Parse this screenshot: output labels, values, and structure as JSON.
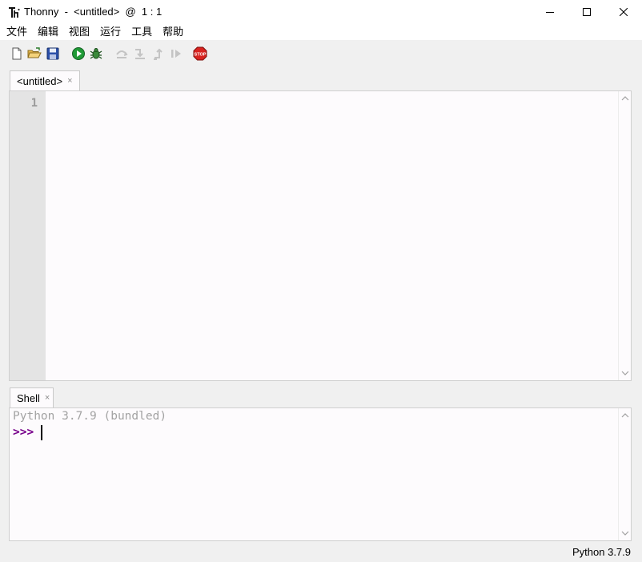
{
  "window": {
    "title": "Thonny  -  <untitled>  @  1 : 1",
    "icon": "thonny-logo-icon"
  },
  "menu": [
    "文件",
    "编辑",
    "视图",
    "运行",
    "工具",
    "帮助"
  ],
  "toolbar": {
    "buttons": [
      {
        "name": "new-file",
        "icon": "new-file-icon",
        "enabled": true
      },
      {
        "name": "open-file",
        "icon": "open-folder-icon",
        "enabled": true
      },
      {
        "name": "save-file",
        "icon": "save-disk-icon",
        "enabled": true
      },
      {
        "name": "run",
        "icon": "run-play-icon",
        "enabled": true
      },
      {
        "name": "debug",
        "icon": "debug-bug-icon",
        "enabled": true
      },
      {
        "name": "step-over",
        "icon": "step-over-icon",
        "enabled": false
      },
      {
        "name": "step-into",
        "icon": "step-into-icon",
        "enabled": false
      },
      {
        "name": "step-out",
        "icon": "step-out-icon",
        "enabled": false
      },
      {
        "name": "resume",
        "icon": "resume-icon",
        "enabled": false
      },
      {
        "name": "stop",
        "icon": "stop-sign-icon",
        "enabled": true
      }
    ],
    "stop_label": "STOP"
  },
  "editor": {
    "tab_label": "<untitled>",
    "tab_close": "×",
    "line_numbers": [
      "1"
    ],
    "content": ""
  },
  "shell": {
    "tab_label": "Shell",
    "tab_close": "×",
    "banner": "Python 3.7.9 (bundled)",
    "prompt": ">>>"
  },
  "status": {
    "interpreter": "Python 3.7.9"
  },
  "colors": {
    "prompt": "#77008b",
    "banner": "#a3a3a3",
    "gutter": "#e4e4e4",
    "editor_bg": "#fdfbfd"
  }
}
